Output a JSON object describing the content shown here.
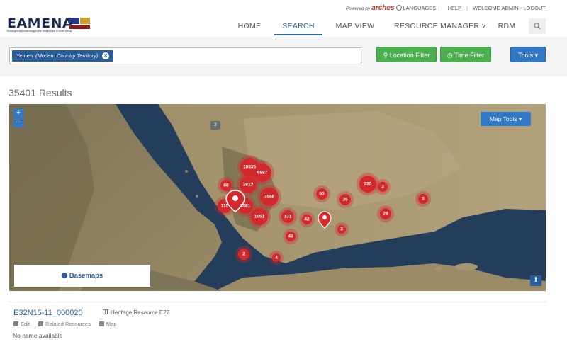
{
  "app": {
    "logo": "EAMENA",
    "logo_tagline": "Endangered Archaeology in the Middle East & North Africa"
  },
  "topbar": {
    "powered_by": "Powered by",
    "brand": "arches",
    "languages": "LANGUAGES",
    "help": "HELP",
    "welcome": "WELCOME ADMIN",
    "logout": "LOGOUT"
  },
  "nav": {
    "items": [
      {
        "label": "HOME",
        "active": false
      },
      {
        "label": "SEARCH",
        "active": true
      },
      {
        "label": "MAP VIEW",
        "active": false
      },
      {
        "label": "RESOURCE MANAGER ˅",
        "active": false
      },
      {
        "label": "RDM",
        "active": false
      }
    ]
  },
  "search": {
    "tag_label": "Yemen",
    "tag_qualifier": "(Modern Country Territory)",
    "remove_glyph": "×"
  },
  "filters": {
    "location": "Location Filter",
    "time": "Time Filter",
    "tools": "Tools ▾"
  },
  "results": {
    "count": "35401 Results"
  },
  "map": {
    "map_tools": "Map Tools ▾",
    "basemaps": "Basemaps",
    "zoom_in": "+",
    "zoom_out": "−",
    "info": "i",
    "gray_marker": "2",
    "clusters": [
      "10535",
      "9887",
      "3613",
      "68",
      "7598",
      "115",
      "1581",
      "1051",
      "131",
      "42",
      "43",
      "50",
      "35",
      "225",
      "3",
      "29",
      "3",
      "3",
      "2",
      "4"
    ],
    "colors": {
      "cluster": "#d4282c",
      "sea": "#243d5a",
      "land": "#8f8262"
    }
  },
  "result_item": {
    "title": "E32N15-11_000020",
    "type": "Heritage Resource E27",
    "edit": "Edit",
    "related": "Related Resources",
    "map": "Map",
    "subtitle": "No name available"
  }
}
